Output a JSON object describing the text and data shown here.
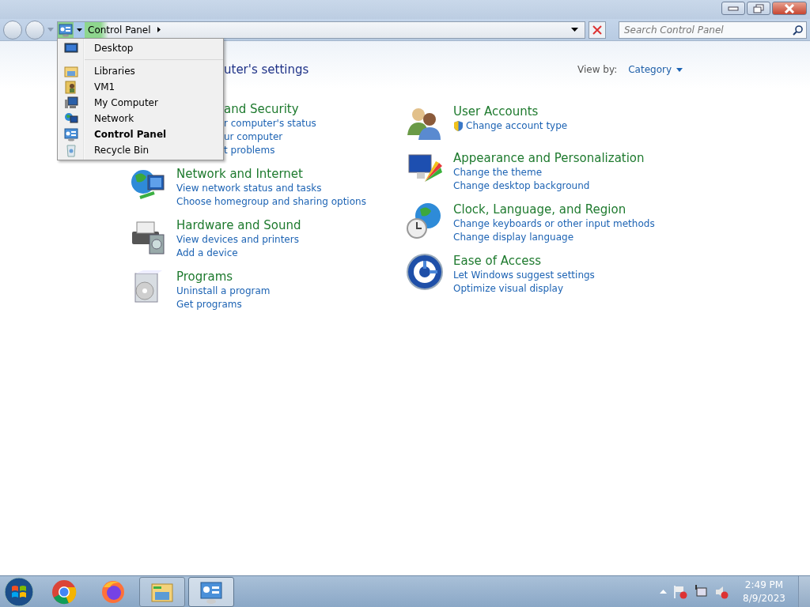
{
  "address_bar": {
    "crumbs": [
      {
        "label": "Control Panel"
      }
    ]
  },
  "search": {
    "placeholder": "Search Control Panel"
  },
  "location_menu": {
    "items": [
      {
        "label": "Desktop",
        "kind": "desktop",
        "selected": false
      },
      {
        "label": "Libraries",
        "kind": "libraries",
        "selected": false
      },
      {
        "label": "VM1",
        "kind": "user-folder",
        "selected": false
      },
      {
        "label": "My Computer",
        "kind": "computer",
        "selected": false
      },
      {
        "label": "Network",
        "kind": "network",
        "selected": false
      },
      {
        "label": "Control Panel",
        "kind": "control-panel",
        "selected": true
      },
      {
        "label": "Recycle Bin",
        "kind": "recycle-bin",
        "selected": false
      }
    ]
  },
  "heading": "uter's settings",
  "view_by": {
    "label": "View by:",
    "value": "Category"
  },
  "columns": [
    [
      {
        "title": "and Security",
        "kind": "security",
        "clipped": true,
        "links": [
          {
            "text": "r computer's status",
            "shield": false
          },
          {
            "text": "ur computer",
            "shield": false
          },
          {
            "text": "t problems",
            "shield": false
          }
        ]
      },
      {
        "title": "Network and Internet",
        "kind": "network",
        "clipped": false,
        "links": [
          {
            "text": "View network status and tasks",
            "shield": false
          },
          {
            "text": "Choose homegroup and sharing options",
            "shield": false
          }
        ]
      },
      {
        "title": "Hardware and Sound",
        "kind": "hardware",
        "clipped": false,
        "links": [
          {
            "text": "View devices and printers",
            "shield": false
          },
          {
            "text": "Add a device",
            "shield": false
          }
        ]
      },
      {
        "title": "Programs",
        "kind": "programs",
        "clipped": false,
        "links": [
          {
            "text": "Uninstall a program",
            "shield": false
          },
          {
            "text": "Get programs",
            "shield": false
          }
        ]
      }
    ],
    [
      {
        "title": "User Accounts",
        "kind": "users",
        "clipped": false,
        "links": [
          {
            "text": "Change account type",
            "shield": true
          }
        ]
      },
      {
        "title": "Appearance and Personalization",
        "kind": "appearance",
        "clipped": false,
        "links": [
          {
            "text": "Change the theme",
            "shield": false
          },
          {
            "text": "Change desktop background",
            "shield": false
          }
        ]
      },
      {
        "title": "Clock, Language, and Region",
        "kind": "clock",
        "clipped": false,
        "links": [
          {
            "text": "Change keyboards or other input methods",
            "shield": false
          },
          {
            "text": "Change display language",
            "shield": false
          }
        ]
      },
      {
        "title": "Ease of Access",
        "kind": "access",
        "clipped": false,
        "links": [
          {
            "text": "Let Windows suggest settings",
            "shield": false
          },
          {
            "text": "Optimize visual display",
            "shield": false
          }
        ]
      }
    ]
  ],
  "taskbar": {
    "apps": [
      {
        "kind": "chrome",
        "active": false
      },
      {
        "kind": "firefox",
        "active": false
      },
      {
        "kind": "explorer",
        "active": false
      },
      {
        "kind": "control-panel",
        "active": true
      }
    ],
    "clock": {
      "time": "2:49 PM",
      "date": "8/9/2023"
    }
  }
}
